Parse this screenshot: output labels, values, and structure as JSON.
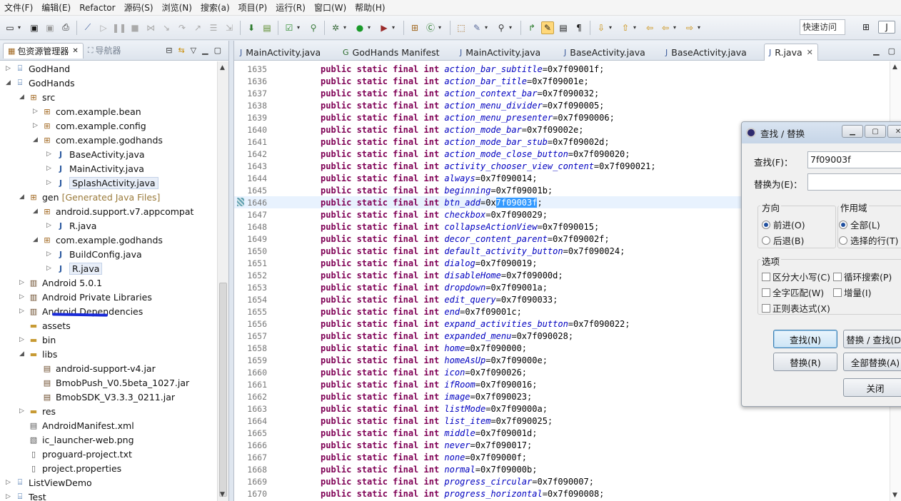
{
  "menu": [
    "文件(F)",
    "编辑(E)",
    "Refactor",
    "源码(S)",
    "浏览(N)",
    "搜索(a)",
    "项目(P)",
    "运行(R)",
    "窗口(W)",
    "帮助(H)"
  ],
  "toolbar": {
    "quick_access": "快速访问"
  },
  "left_panel": {
    "tab_active": "包资源管理器",
    "tab_inactive": "导航器",
    "tree": [
      {
        "label": "GodHand",
        "icon": "project-icon",
        "depth": 0,
        "arrow": "▷"
      },
      {
        "label": "GodHands",
        "icon": "project-icon",
        "depth": 0,
        "arrow": "◢"
      },
      {
        "label": "src",
        "icon": "source-folder-icon",
        "depth": 1,
        "arrow": "◢"
      },
      {
        "label": "com.example.bean",
        "icon": "package-icon",
        "depth": 2,
        "arrow": "▷"
      },
      {
        "label": "com.example.config",
        "icon": "package-icon",
        "depth": 2,
        "arrow": "▷"
      },
      {
        "label": "com.example.godhands",
        "icon": "package-icon",
        "depth": 2,
        "arrow": "◢"
      },
      {
        "label": "BaseActivity.java",
        "icon": "java-file-icon",
        "depth": 3,
        "arrow": "▷"
      },
      {
        "label": "MainActivity.java",
        "icon": "java-file-icon",
        "depth": 3,
        "arrow": "▷"
      },
      {
        "label": "SplashActivity.java",
        "icon": "java-file-icon",
        "depth": 3,
        "arrow": "▷",
        "highlight": true
      },
      {
        "label": "gen",
        "extra": "[Generated Java Files]",
        "icon": "source-folder-icon",
        "depth": 1,
        "arrow": "◢"
      },
      {
        "label": "android.support.v7.appcompat",
        "icon": "package-icon",
        "depth": 2,
        "arrow": "◢"
      },
      {
        "label": "R.java",
        "icon": "java-file-icon",
        "depth": 3,
        "arrow": "▷"
      },
      {
        "label": "com.example.godhands",
        "icon": "package-icon",
        "depth": 2,
        "arrow": "◢"
      },
      {
        "label": "BuildConfig.java",
        "icon": "java-file-icon",
        "depth": 3,
        "arrow": "▷"
      },
      {
        "label": "R.java",
        "icon": "java-file-icon",
        "depth": 3,
        "arrow": "▷",
        "highlight": true
      },
      {
        "label": "Android 5.0.1",
        "icon": "library-icon",
        "depth": 1,
        "arrow": "▷"
      },
      {
        "label": "Android Private Libraries",
        "icon": "library-icon",
        "depth": 1,
        "arrow": "▷"
      },
      {
        "label": "Android Dependencies",
        "icon": "library-icon",
        "depth": 1,
        "arrow": "▷"
      },
      {
        "label": "assets",
        "icon": "folder-icon",
        "depth": 1,
        "arrow": ""
      },
      {
        "label": "bin",
        "icon": "folder-icon",
        "depth": 1,
        "arrow": "▷"
      },
      {
        "label": "libs",
        "icon": "folder-icon",
        "depth": 1,
        "arrow": "◢"
      },
      {
        "label": "android-support-v4.jar",
        "icon": "jar-icon",
        "depth": 2,
        "arrow": ""
      },
      {
        "label": "BmobPush_V0.5beta_1027.jar",
        "icon": "jar-icon",
        "depth": 2,
        "arrow": ""
      },
      {
        "label": "BmobSDK_V3.3.3_0211.jar",
        "icon": "jar-icon",
        "depth": 2,
        "arrow": ""
      },
      {
        "label": "res",
        "icon": "folder-icon",
        "depth": 1,
        "arrow": "▷"
      },
      {
        "label": "AndroidManifest.xml",
        "icon": "xml-file-icon",
        "depth": 1,
        "arrow": ""
      },
      {
        "label": "ic_launcher-web.png",
        "icon": "image-file-icon",
        "depth": 1,
        "arrow": ""
      },
      {
        "label": "proguard-project.txt",
        "icon": "text-file-icon",
        "depth": 1,
        "arrow": ""
      },
      {
        "label": "project.properties",
        "icon": "text-file-icon",
        "depth": 1,
        "arrow": ""
      },
      {
        "label": "ListViewDemo",
        "icon": "project-icon",
        "depth": 0,
        "arrow": "▷"
      },
      {
        "label": "Test",
        "icon": "project-icon",
        "depth": 0,
        "arrow": "▷"
      }
    ]
  },
  "editor": {
    "tabs": [
      {
        "label": "MainActivity.java",
        "icon": "java-file-icon"
      },
      {
        "label": "GodHands Manifest",
        "icon": "manifest-icon"
      },
      {
        "label": "MainActivity.java",
        "icon": "java-file-icon"
      },
      {
        "label": "BaseActivity.java",
        "icon": "java-file-icon"
      },
      {
        "label": "BaseActivity.java",
        "icon": "java-file-icon"
      },
      {
        "label": "R.java",
        "icon": "java-file-icon",
        "active": true
      }
    ],
    "modifier": "public static final int",
    "lines": [
      {
        "n": "1635",
        "name": "action_bar_subtitle",
        "value": "0x7f09001f"
      },
      {
        "n": "1636",
        "name": "action_bar_title",
        "value": "0x7f09001e"
      },
      {
        "n": "1637",
        "name": "action_context_bar",
        "value": "0x7f090032"
      },
      {
        "n": "1638",
        "name": "action_menu_divider",
        "value": "0x7f090005"
      },
      {
        "n": "1639",
        "name": "action_menu_presenter",
        "value": "0x7f090006"
      },
      {
        "n": "1640",
        "name": "action_mode_bar",
        "value": "0x7f09002e"
      },
      {
        "n": "1641",
        "name": "action_mode_bar_stub",
        "value": "0x7f09002d"
      },
      {
        "n": "1642",
        "name": "action_mode_close_button",
        "value": "0x7f090020"
      },
      {
        "n": "1643",
        "name": "activity_chooser_view_content",
        "value": "0x7f090021"
      },
      {
        "n": "1644",
        "name": "always",
        "value": "0x7f090014"
      },
      {
        "n": "1645",
        "name": "beginning",
        "value": "0x7f09001b"
      },
      {
        "n": "1646",
        "name": "btn_add",
        "value": "0x7f09003f",
        "current": true,
        "match_prefix": "0x",
        "match": "7f09003f"
      },
      {
        "n": "1647",
        "name": "checkbox",
        "value": "0x7f090029"
      },
      {
        "n": "1648",
        "name": "collapseActionView",
        "value": "0x7f090015"
      },
      {
        "n": "1649",
        "name": "decor_content_parent",
        "value": "0x7f09002f"
      },
      {
        "n": "1650",
        "name": "default_activity_button",
        "value": "0x7f090024"
      },
      {
        "n": "1651",
        "name": "dialog",
        "value": "0x7f090019"
      },
      {
        "n": "1652",
        "name": "disableHome",
        "value": "0x7f09000d"
      },
      {
        "n": "1653",
        "name": "dropdown",
        "value": "0x7f09001a"
      },
      {
        "n": "1654",
        "name": "edit_query",
        "value": "0x7f090033"
      },
      {
        "n": "1655",
        "name": "end",
        "value": "0x7f09001c"
      },
      {
        "n": "1656",
        "name": "expand_activities_button",
        "value": "0x7f090022"
      },
      {
        "n": "1657",
        "name": "expanded_menu",
        "value": "0x7f090028"
      },
      {
        "n": "1658",
        "name": "home",
        "value": "0x7f090000"
      },
      {
        "n": "1659",
        "name": "homeAsUp",
        "value": "0x7f09000e"
      },
      {
        "n": "1660",
        "name": "icon",
        "value": "0x7f090026"
      },
      {
        "n": "1661",
        "name": "ifRoom",
        "value": "0x7f090016"
      },
      {
        "n": "1662",
        "name": "image",
        "value": "0x7f090023"
      },
      {
        "n": "1663",
        "name": "listMode",
        "value": "0x7f09000a"
      },
      {
        "n": "1664",
        "name": "list_item",
        "value": "0x7f090025"
      },
      {
        "n": "1665",
        "name": "middle",
        "value": "0x7f09001d"
      },
      {
        "n": "1666",
        "name": "never",
        "value": "0x7f090017"
      },
      {
        "n": "1667",
        "name": "none",
        "value": "0x7f09000f"
      },
      {
        "n": "1668",
        "name": "normal",
        "value": "0x7f09000b"
      },
      {
        "n": "1669",
        "name": "progress_circular",
        "value": "0x7f090007"
      },
      {
        "n": "1670",
        "name": "progress_horizontal",
        "value": "0x7f090008"
      }
    ]
  },
  "dialog": {
    "title": "查找 / 替换",
    "find_label": "查找(F)：",
    "find_value": "7f09003f",
    "replace_label": "替换为(E)：",
    "replace_value": "",
    "direction_title": "方向",
    "direction_forward": "前进(O)",
    "direction_backward": "后退(B)",
    "scope_title": "作用域",
    "scope_all": "全部(L)",
    "scope_selected": "选择的行(T)",
    "options_title": "选项",
    "opt_case": "区分大小写(C)",
    "opt_wrap": "循环搜索(P)",
    "opt_whole": "全字匹配(W)",
    "opt_incremental": "增量(I)",
    "opt_regex": "正则表达式(X)",
    "btn_find": "查找(N)",
    "btn_replace_find": "替换 / 查找(D)",
    "btn_replace": "替换(R)",
    "btn_replace_all": "全部替换(A)",
    "btn_close": "关闭"
  },
  "colors": {
    "keyword": "#7f0055",
    "field": "#0000c0",
    "selection": "#3399ff",
    "current_line": "#e8f2fe"
  }
}
